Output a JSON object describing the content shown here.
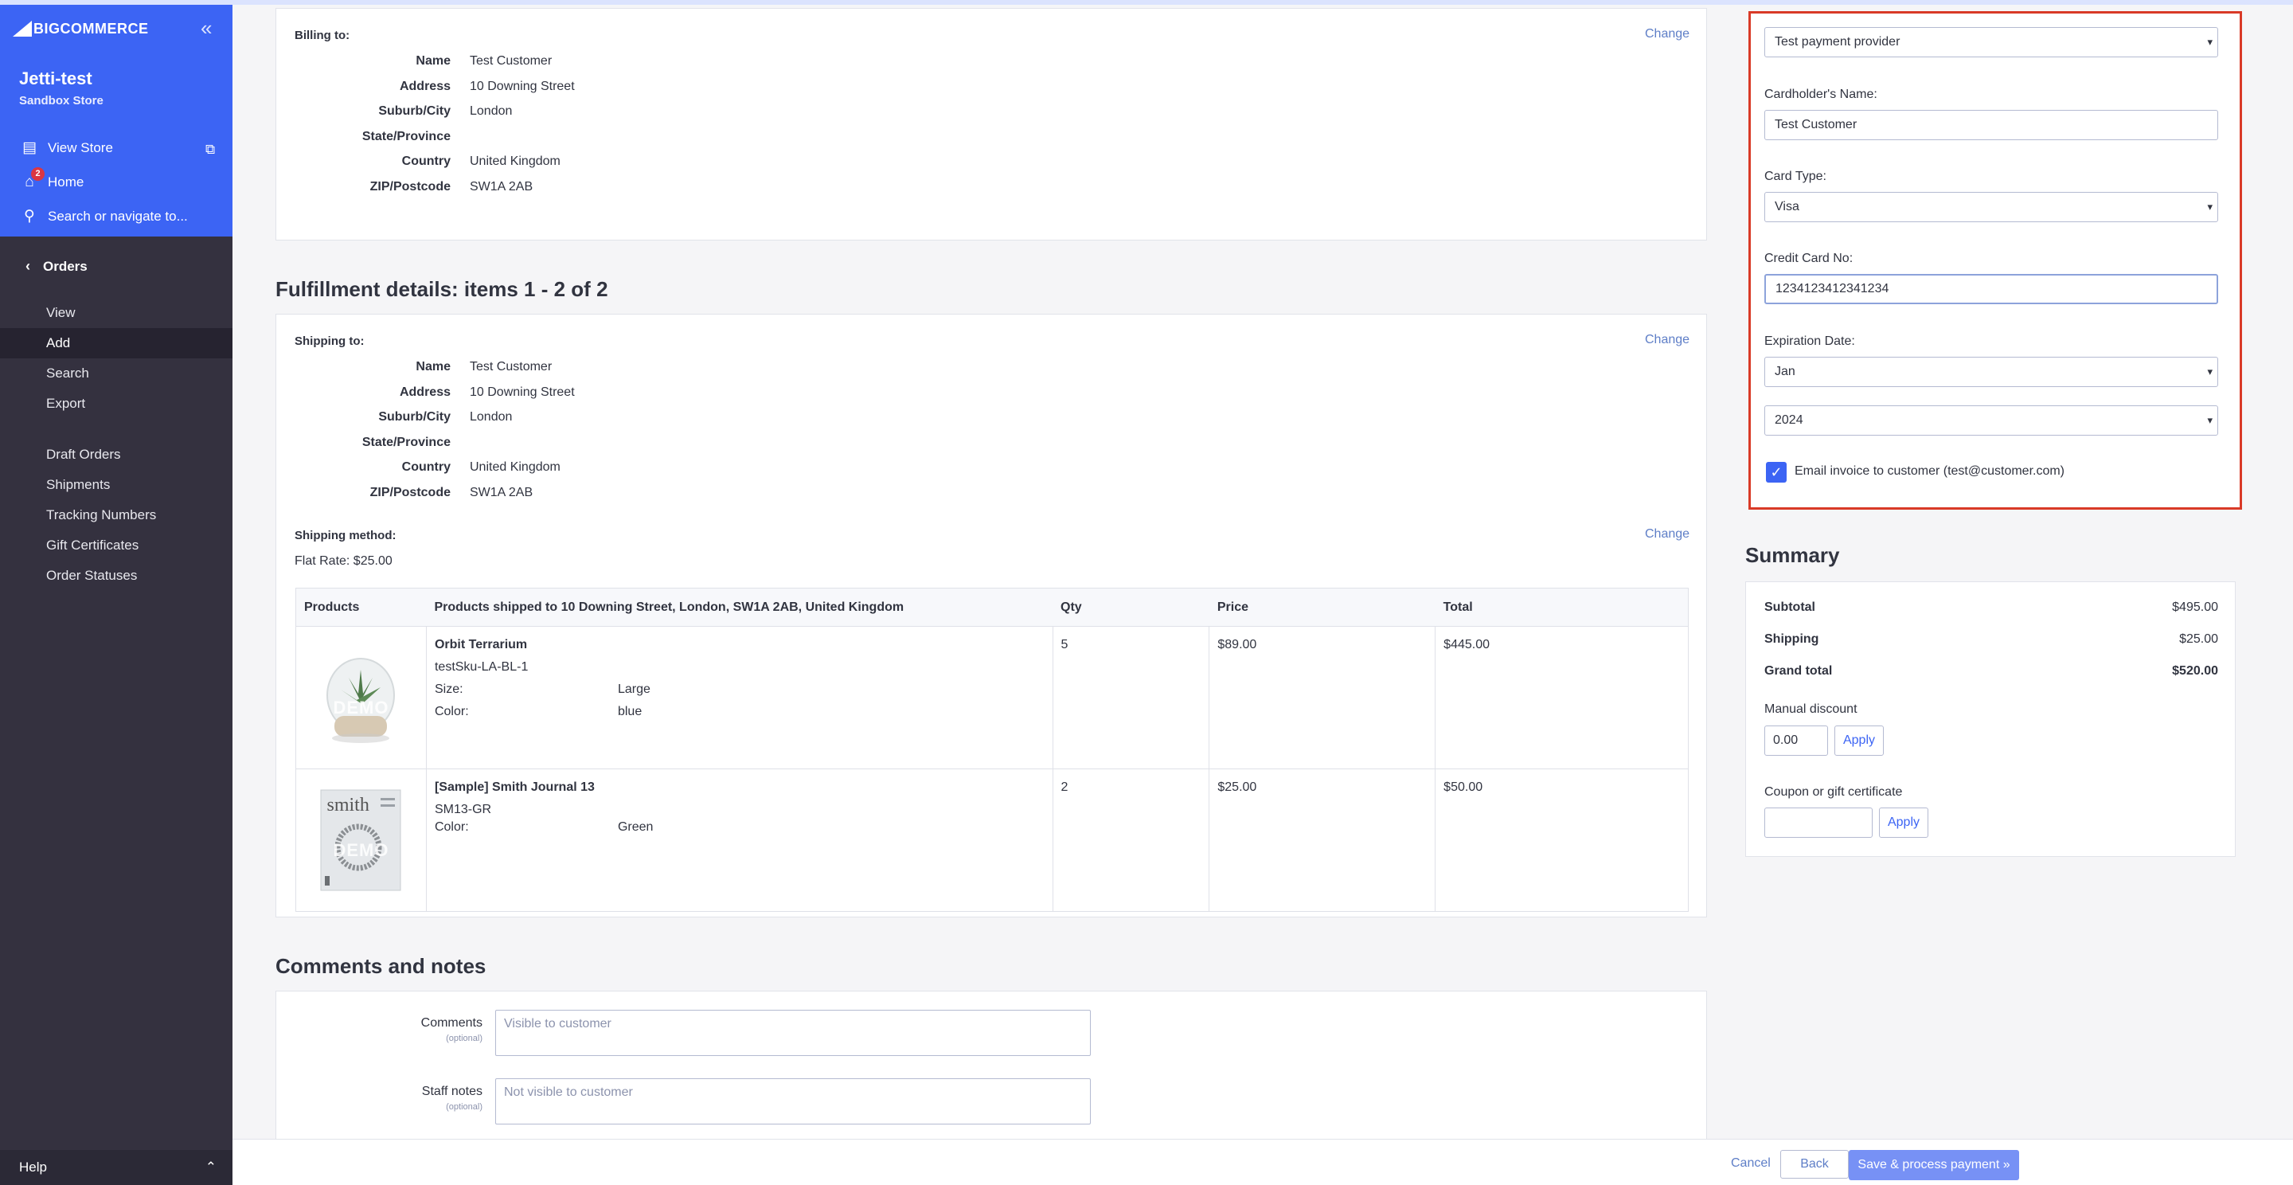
{
  "sidebar": {
    "logo": "BIGCOMMERCE",
    "store_name": "Jetti-test",
    "store_type": "Sandbox Store",
    "view_store": "View Store",
    "home": "Home",
    "home_badge": "2",
    "search": "Search or navigate to...",
    "orders": "Orders",
    "sub_items": [
      "View",
      "Add",
      "Search",
      "Export",
      "Draft Orders",
      "Shipments",
      "Tracking Numbers",
      "Gift Certificates",
      "Order Statuses"
    ],
    "active_item": "Add",
    "help": "Help"
  },
  "billing": {
    "heading": "Billing to:",
    "change": "Change",
    "rows": [
      {
        "k": "Name",
        "v": "Test Customer"
      },
      {
        "k": "Address",
        "v": "10 Downing Street"
      },
      {
        "k": "Suburb/City",
        "v": "London"
      },
      {
        "k": "State/Province",
        "v": ""
      },
      {
        "k": "Country",
        "v": "United Kingdom"
      },
      {
        "k": "ZIP/Postcode",
        "v": "SW1A 2AB"
      }
    ]
  },
  "fulfillment": {
    "title": "Fulfillment details: items 1 - 2 of 2",
    "shipping_heading": "Shipping to:",
    "change": "Change",
    "rows": [
      {
        "k": "Name",
        "v": "Test Customer"
      },
      {
        "k": "Address",
        "v": "10 Downing Street"
      },
      {
        "k": "Suburb/City",
        "v": "London"
      },
      {
        "k": "State/Province",
        "v": ""
      },
      {
        "k": "Country",
        "v": "United Kingdom"
      },
      {
        "k": "ZIP/Postcode",
        "v": "SW1A 2AB"
      }
    ],
    "method_heading": "Shipping method:",
    "method_change": "Change",
    "method_value": "Flat Rate: $25.00",
    "table": {
      "headers": [
        "Products",
        "Products shipped to 10 Downing Street, London, SW1A 2AB, United Kingdom",
        "Qty",
        "Price",
        "Total"
      ],
      "rows": [
        {
          "name": "Orbit Terrarium",
          "sku": "testSku-LA-BL-1",
          "attrs": [
            {
              "k": "Size:",
              "v": "Large"
            },
            {
              "k": "Color:",
              "v": "blue"
            }
          ],
          "qty": "5",
          "price": "$89.00",
          "total": "$445.00",
          "thumb_watermark": "DEMO"
        },
        {
          "name": "[Sample] Smith Journal 13",
          "sku": "SM13-GR",
          "attrs": [
            {
              "k": "Color:",
              "v": "Green"
            }
          ],
          "qty": "2",
          "price": "$25.00",
          "total": "$50.00",
          "thumb_watermark": "DEMO",
          "thumb_text": "smith"
        }
      ]
    }
  },
  "comments": {
    "title": "Comments and notes",
    "comments_label": "Comments",
    "comments_opt": "(optional)",
    "comments_placeholder": "Visible to customer",
    "staff_label": "Staff notes",
    "staff_opt": "(optional)",
    "staff_placeholder": "Not visible to customer"
  },
  "payment": {
    "provider": "Test payment provider",
    "cardholder_label": "Cardholder's Name:",
    "cardholder_value": "Test Customer",
    "card_type_label": "Card Type:",
    "card_type_value": "Visa",
    "cc_label": "Credit Card No:",
    "cc_value": "1234123412341234",
    "exp_label": "Expiration Date:",
    "exp_month": "Jan",
    "exp_year": "2024",
    "email_invoice": "Email invoice to customer (test@customer.com)",
    "email_checked": true
  },
  "summary": {
    "title": "Summary",
    "subtotal_k": "Subtotal",
    "subtotal_v": "$495.00",
    "shipping_k": "Shipping",
    "shipping_v": "$25.00",
    "grand_k": "Grand total",
    "grand_v": "$520.00",
    "discount_label": "Manual discount",
    "discount_value": "0.00",
    "apply": "Apply",
    "coupon_label": "Coupon or gift certificate",
    "coupon_apply": "Apply"
  },
  "footer": {
    "cancel": "Cancel",
    "back": "Back",
    "save": "Save & process payment »"
  },
  "colors": {
    "accent": "#3c64f4",
    "sidebar_bg": "#34313f",
    "highlight": "#d93a27"
  }
}
